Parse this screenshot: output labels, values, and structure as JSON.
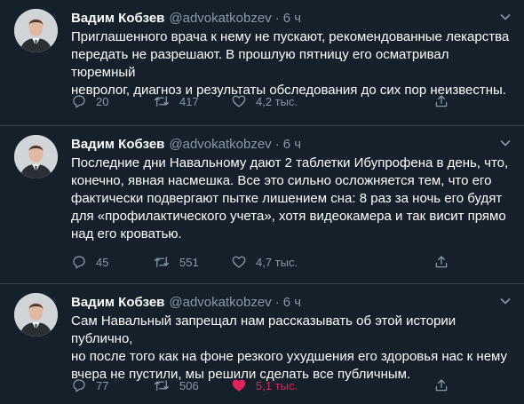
{
  "colors": {
    "background": "#15202b",
    "divider": "#38444d",
    "text_primary": "#ffffff",
    "text_secondary": "#8899a6",
    "like_active": "#e0245e"
  },
  "tweets": [
    {
      "author": {
        "name": "Вадим Кобзев",
        "handle": "@advokatkobzev",
        "dot": "·",
        "time": "6 ч"
      },
      "text": "Приглашенного врача к нему не пускают, рекомендованные лекарства\nпередать не разрешают. В прошлую пятницу его осматривал тюремный\nневролог, диагноз и результаты обследования до сих пор неизвестны.",
      "stats": {
        "replies": "20",
        "retweets": "417",
        "likes": "4,2 тыс.",
        "liked": false
      }
    },
    {
      "author": {
        "name": "Вадим Кобзев",
        "handle": "@advokatkobzev",
        "dot": "·",
        "time": "6 ч"
      },
      "text": "Последние дни Навальному дают 2 таблетки Ибупрофена в день, что,\nконечно, явная насмешка. Все это сильно осложняется тем, что его\nфактически подвергают пытке лишением сна: 8 раз за ночь его будят\nдля «профилактического учета», хотя видеокамера и так висит прямо\nнад его кроватью.",
      "stats": {
        "replies": "45",
        "retweets": "551",
        "likes": "4,7 тыс.",
        "liked": false
      }
    },
    {
      "author": {
        "name": "Вадим Кобзев",
        "handle": "@advokatkobzev",
        "dot": "·",
        "time": "6 ч"
      },
      "text": "Сам Навальный запрещал нам рассказывать об этой истории публично,\nно после того как на фоне резкого ухудшения его здоровья нас к нему\nвчера не пустили, мы решили сделать все публичным.",
      "stats": {
        "replies": "77",
        "retweets": "506",
        "likes": "5,1 тыс.",
        "liked": true
      }
    }
  ],
  "icons": {
    "more": "chevron-down-icon",
    "reply": "reply-icon",
    "retweet": "retweet-icon",
    "like": "heart-icon",
    "share": "share-icon"
  }
}
